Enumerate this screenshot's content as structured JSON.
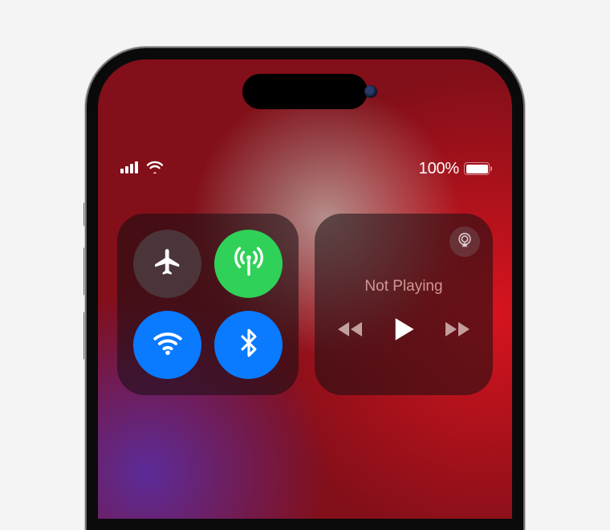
{
  "status": {
    "battery_percent": "100%",
    "battery_fill_pct": 100
  },
  "connectivity": {
    "airplane": {
      "name": "airplane-mode",
      "on": false
    },
    "cellular": {
      "name": "cellular-data",
      "on": true
    },
    "wifi": {
      "name": "wifi",
      "on": true
    },
    "bluetooth": {
      "name": "bluetooth",
      "on": true
    }
  },
  "media": {
    "title": "Not Playing"
  },
  "colors": {
    "toggle_green": "#30d158",
    "toggle_blue": "#0a7aff"
  }
}
